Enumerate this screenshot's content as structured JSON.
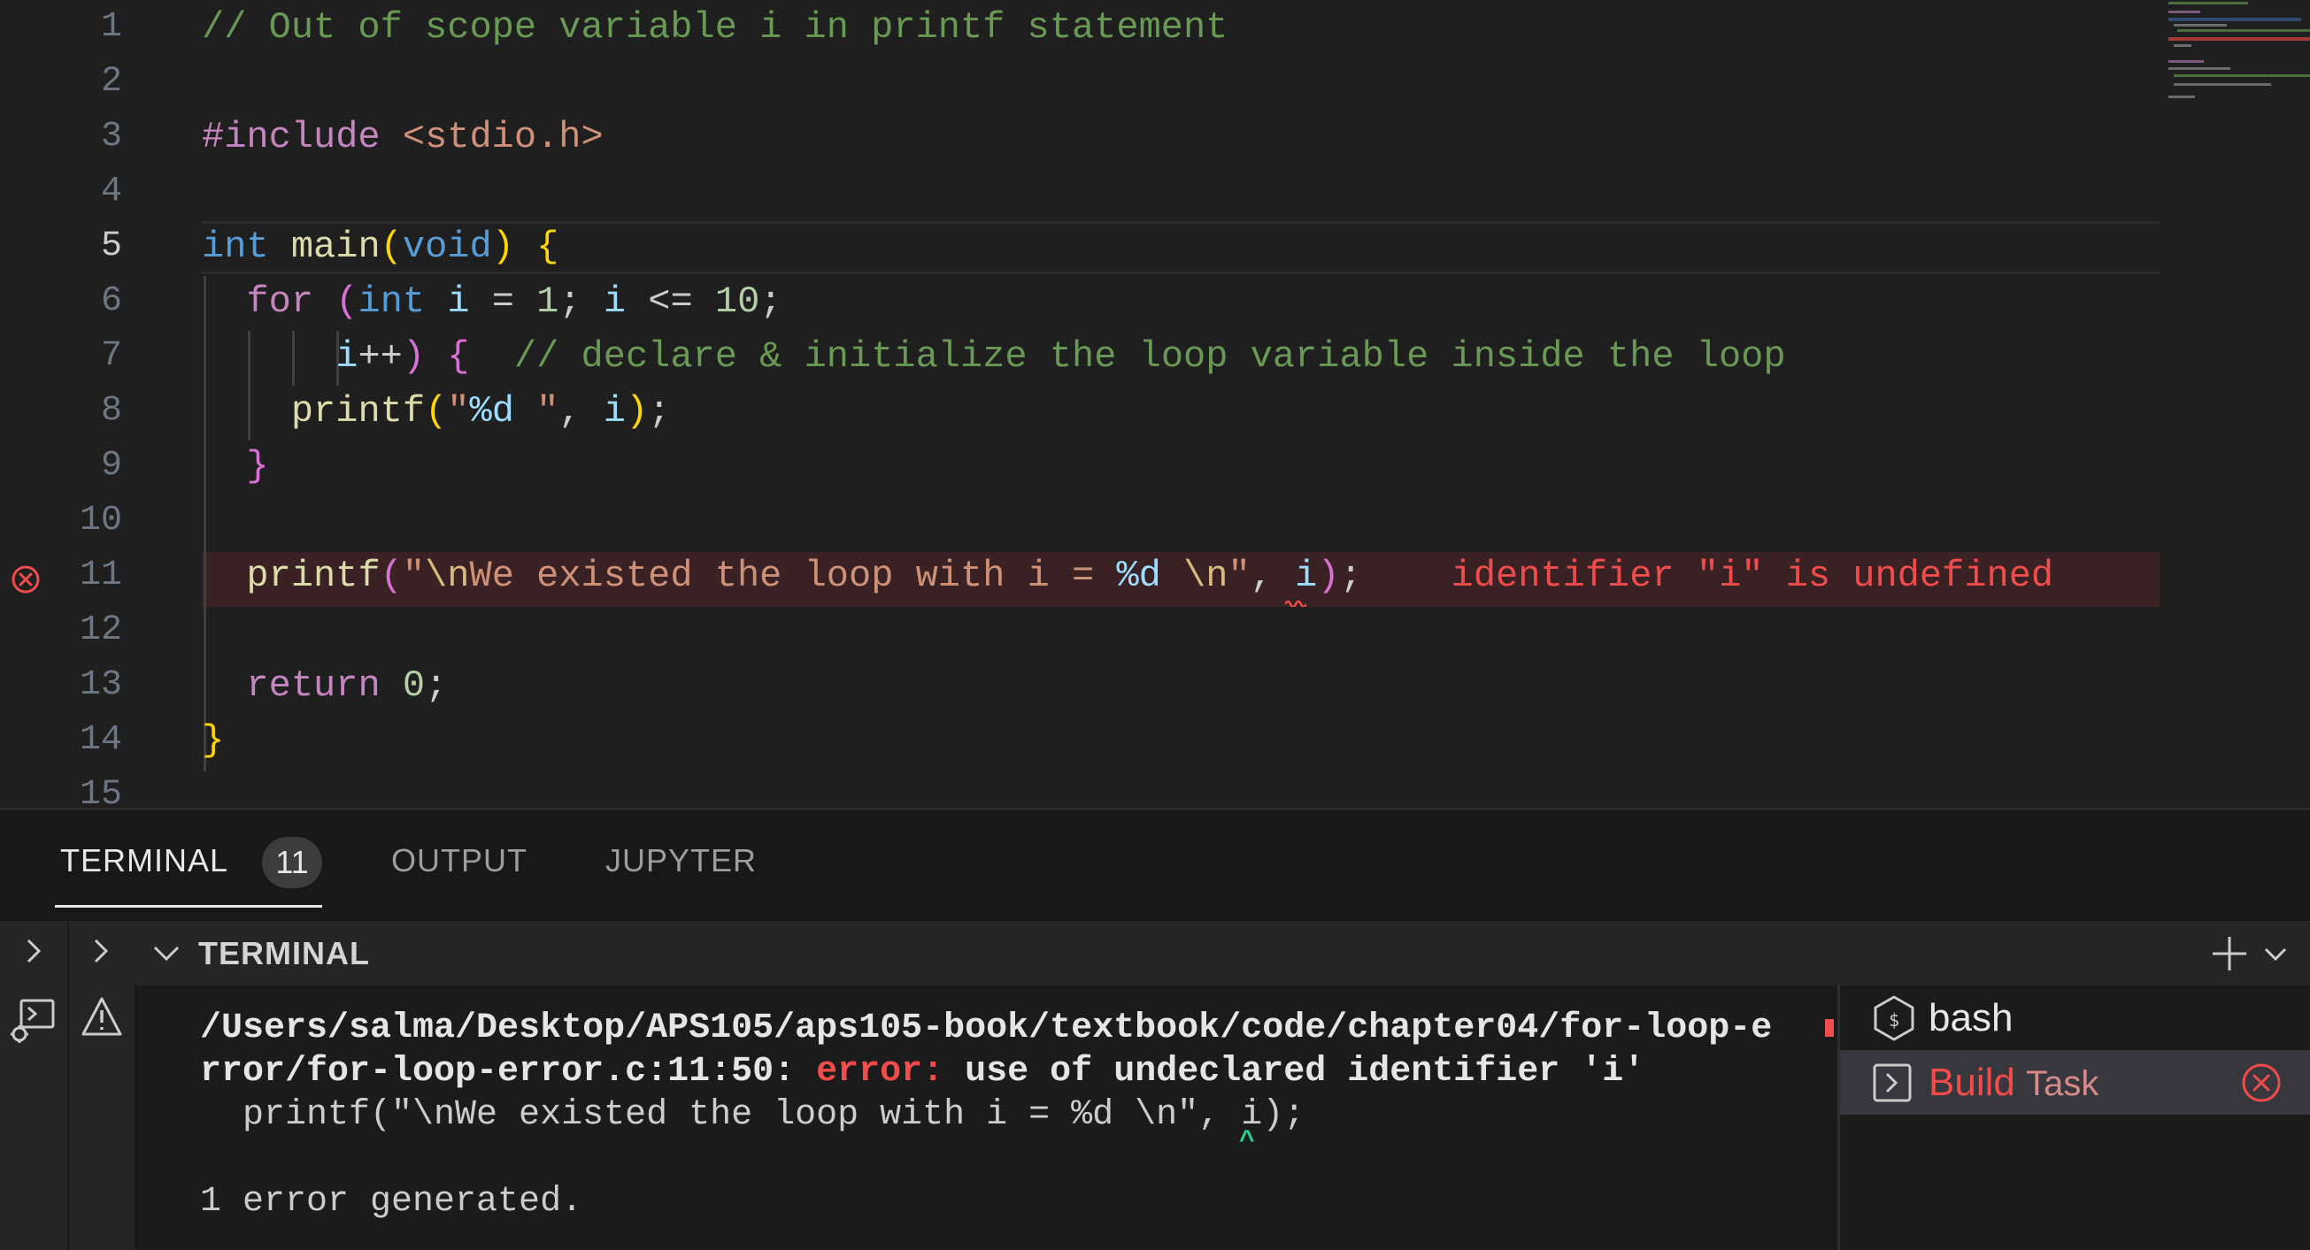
{
  "editor": {
    "active_line": 5,
    "lines": [
      {
        "n": "1"
      },
      {
        "n": "2"
      },
      {
        "n": "3"
      },
      {
        "n": "4"
      },
      {
        "n": "5"
      },
      {
        "n": "6"
      },
      {
        "n": "7"
      },
      {
        "n": "8"
      },
      {
        "n": "9"
      },
      {
        "n": "10"
      },
      {
        "n": "11"
      },
      {
        "n": "12"
      },
      {
        "n": "13"
      },
      {
        "n": "14"
      },
      {
        "n": "15"
      }
    ],
    "code": {
      "l1_comment": "// Out of scope variable i in printf statement",
      "l3_directive": "#include",
      "l3_header": "<stdio.h>",
      "l5_type": "int",
      "l5_fn": "main",
      "l5_paren_open": "(",
      "l5_param": "void",
      "l5_paren_close": ")",
      "l5_brace": "{",
      "l6_for": "for",
      "l6_paren": "(",
      "l6_int": "int",
      "l6_var1": "i",
      "l6_op1": " = ",
      "l6_num1": "1",
      "l6_semi1": "; ",
      "l6_var2": "i",
      "l6_op2": " <= ",
      "l6_num2": "10",
      "l6_semi2": ";",
      "l7_var": "i",
      "l7_inc": "++",
      "l7_paren": ")",
      "l7_brace": " {  ",
      "l7_comment": "// declare & initialize the loop variable inside the loop",
      "l8_fn": "printf",
      "l8_paren": "(",
      "l8_q1": "\"",
      "l8_fmt": "%d",
      "l8_q2": " \"",
      "l8_comma": ", ",
      "l8_var": "i",
      "l8_paren_close": ")",
      "l8_semi": ";",
      "l9_brace": "}",
      "l11_fn": "printf",
      "l11_paren": "(",
      "l11_str1": "\"",
      "l11_esc1": "\\n",
      "l11_str2": "We existed the loop with i = ",
      "l11_fmt": "%d",
      "l11_str3": " ",
      "l11_esc2": "\\n",
      "l11_str4": "\"",
      "l11_comma": ", ",
      "l11_var": "i",
      "l11_paren_close": ")",
      "l11_semi": ";",
      "l11_error": "identifier \"i\" is undefined",
      "l13_return": "return",
      "l13_num": "0",
      "l13_semi": ";",
      "l14_brace": "}"
    },
    "colors": {
      "error": "#f14c4c",
      "error_line_bg": "#3a2224",
      "comment": "#6a9955",
      "keyword": "#c586c0",
      "type": "#569cd6"
    }
  },
  "panel": {
    "tabs": [
      {
        "label": "TERMINAL",
        "badge": "11",
        "active": true
      },
      {
        "label": "OUTPUT",
        "active": false
      },
      {
        "label": "JUPYTER",
        "active": false
      }
    ],
    "terminal_header": "TERMINAL",
    "terminal_lines": {
      "path": "/Users/salma/Desktop/APS105/aps105-book/textbook/code/chapter04/for-loop-e",
      "path2": "rror/for-loop-error.c:11:50: ",
      "error_label": "error:",
      "error_msg": " use of undeclared identifier 'i'",
      "source": "  printf(\"\\nWe existed the loop with i = %d \\n\", i);",
      "caret": "^",
      "summary": "1 error generated."
    },
    "terminal_list": [
      {
        "label": "bash",
        "icon": "terminal-bash-icon",
        "selected": false
      },
      {
        "label": "Build",
        "sublabel": "Task",
        "icon": "terminal-task-icon",
        "selected": true
      }
    ],
    "icons": [
      "chevron-right-icon",
      "debug-console-icon",
      "warning-icon",
      "chevron-down-icon",
      "plus-icon",
      "dropdown-icon",
      "close-circle-icon"
    ]
  }
}
